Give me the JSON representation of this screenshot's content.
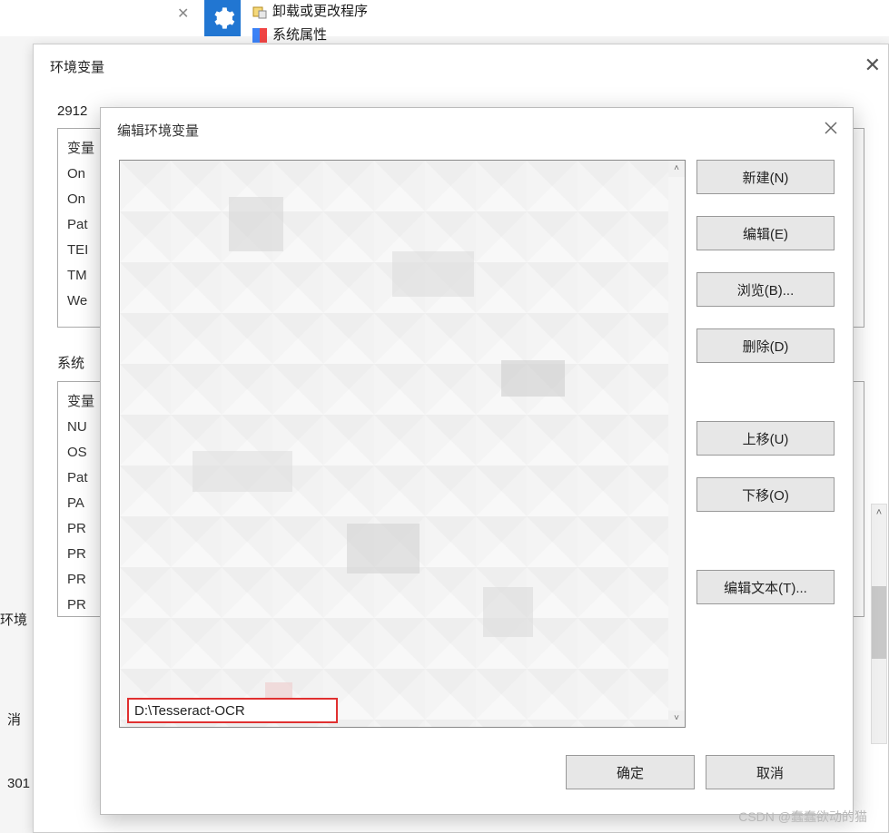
{
  "bg": {
    "link_uninstall": "卸载或更改程序",
    "link_sysprop": "系统属性"
  },
  "env_dialog": {
    "title": "环境变量",
    "user_section_prefix": "2912",
    "user_vars_header": "变量",
    "user_vars": [
      "On",
      "On",
      "Pat",
      "TEI",
      "TM",
      "We"
    ],
    "sys_section_prefix": "系统",
    "sys_vars": [
      "变量",
      "NU",
      "OS",
      "Pat",
      "PA",
      "PR",
      "PR",
      "PR",
      "PR"
    ],
    "side_env": "环境",
    "side_cancel": "消",
    "side_num": "301"
  },
  "edit_dialog": {
    "title": "编辑环境变量",
    "highlighted_path": "D:\\Tesseract-OCR",
    "buttons": {
      "new": "新建(N)",
      "edit": "编辑(E)",
      "browse": "浏览(B)...",
      "delete": "删除(D)",
      "move_up": "上移(U)",
      "move_down": "下移(O)",
      "edit_text": "编辑文本(T)...",
      "ok": "确定",
      "cancel": "取消"
    }
  },
  "watermark": "CSDN @蠢蠢欲动的猫"
}
